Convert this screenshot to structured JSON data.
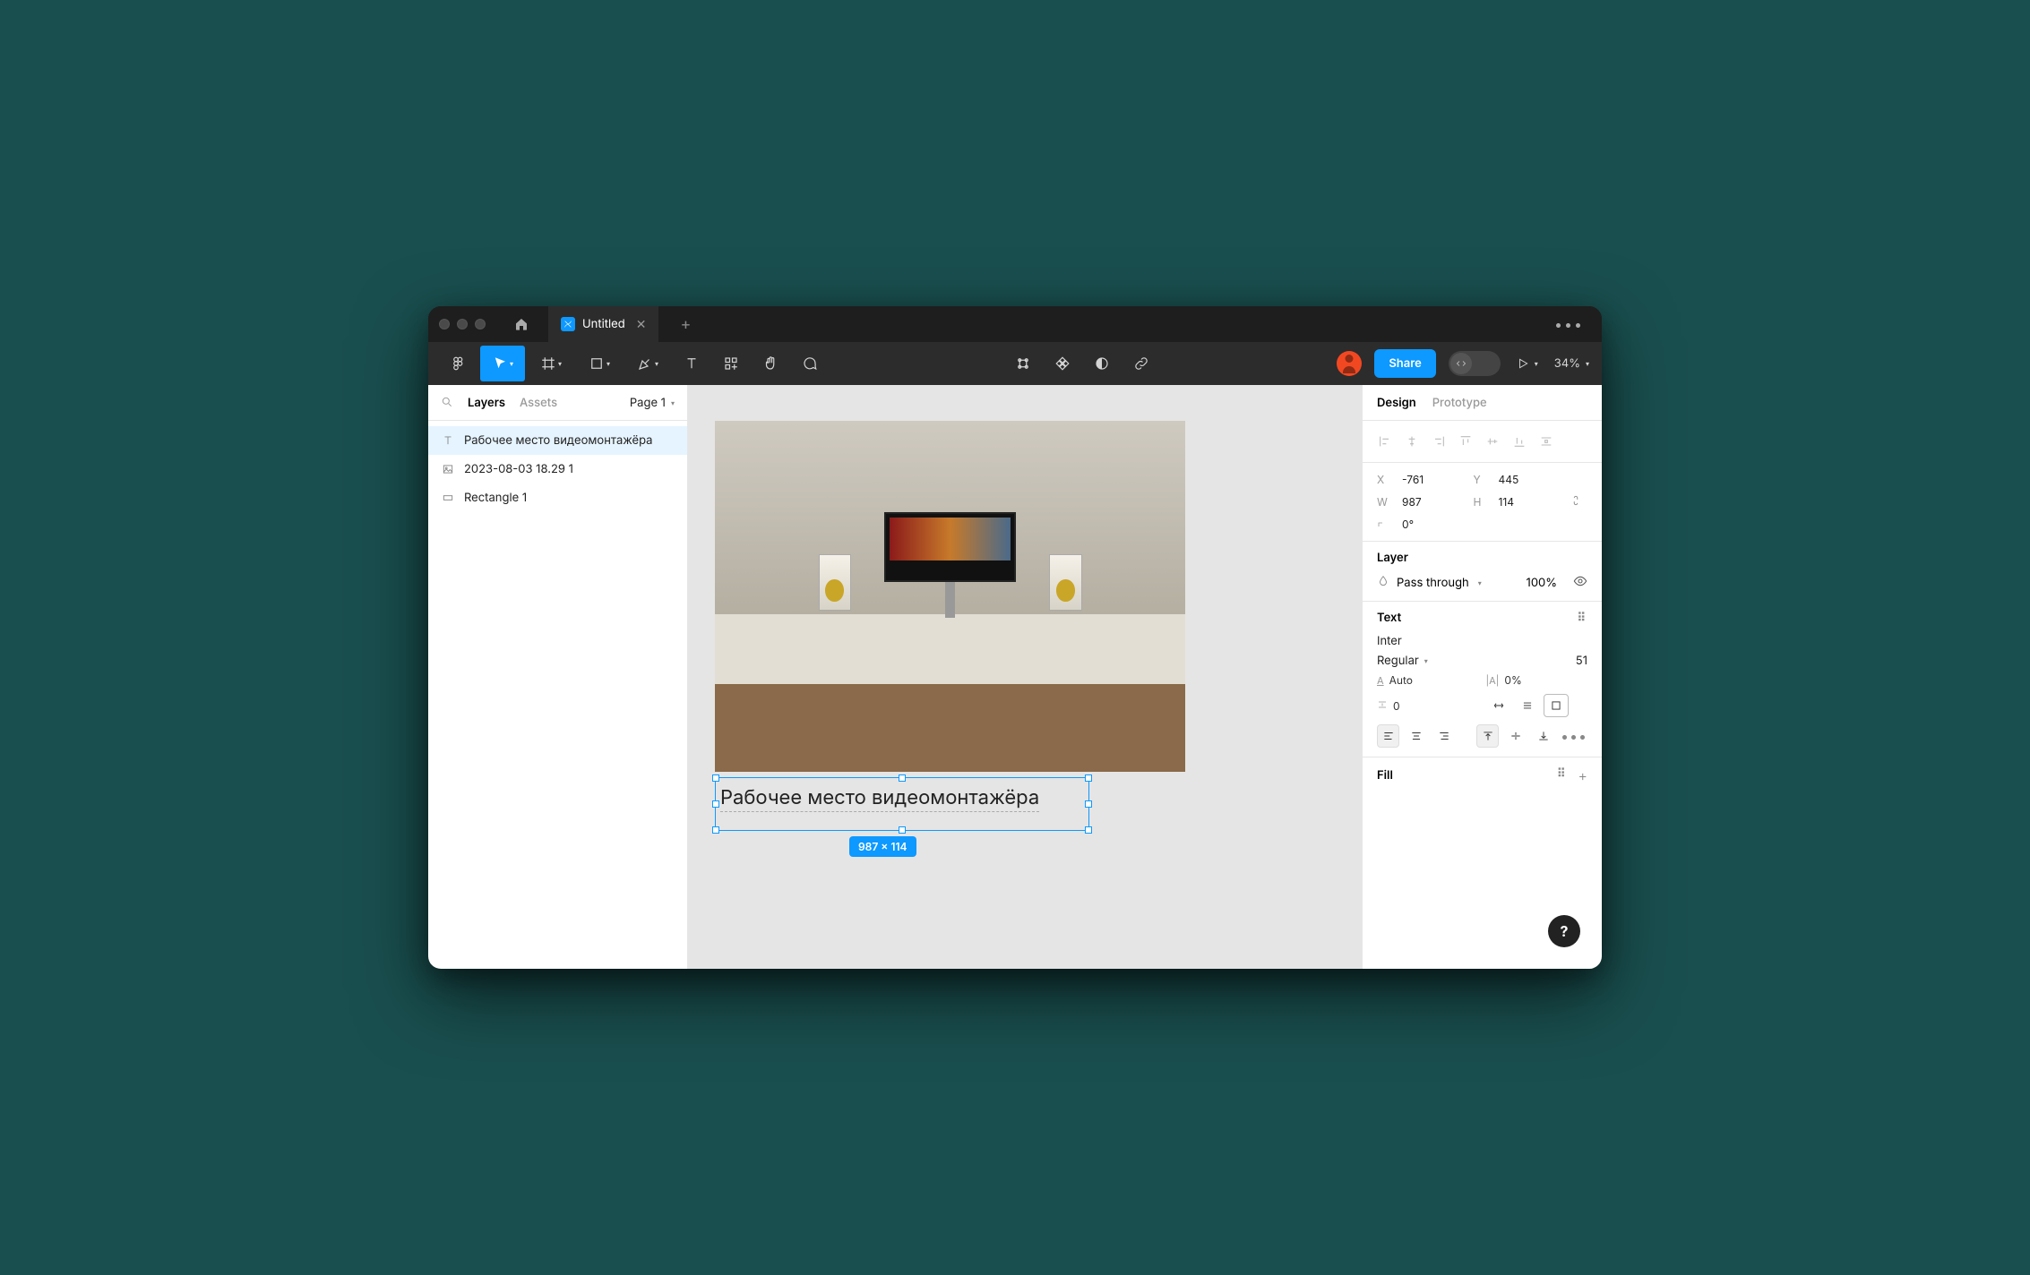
{
  "tabs": {
    "document_title": "Untitled"
  },
  "toolbar_right": {
    "share_label": "Share",
    "zoom_label": "34%"
  },
  "left_panel": {
    "tab_layers": "Layers",
    "tab_assets": "Assets",
    "page_label": "Page 1",
    "layers": [
      {
        "name": "Рабочее место видеомонтажёра",
        "icon": "text"
      },
      {
        "name": "2023-08-03 18.29 1",
        "icon": "image"
      },
      {
        "name": "Rectangle 1",
        "icon": "rect"
      }
    ]
  },
  "canvas": {
    "text_content": "Рабочее место видеомонтажёра",
    "dims_label": "987 × 114"
  },
  "right_panel": {
    "tab_design": "Design",
    "tab_prototype": "Prototype",
    "x": "-761",
    "y": "445",
    "w": "987",
    "h": "114",
    "rotation": "0°",
    "section_layer": "Layer",
    "blend_mode": "Pass through",
    "opacity": "100%",
    "section_text": "Text",
    "font_family": "Inter",
    "font_weight": "Regular",
    "font_size": "51",
    "line_height": "Auto",
    "letter_spacing": "0%",
    "paragraph_spacing": "0",
    "section_fill": "Fill"
  }
}
